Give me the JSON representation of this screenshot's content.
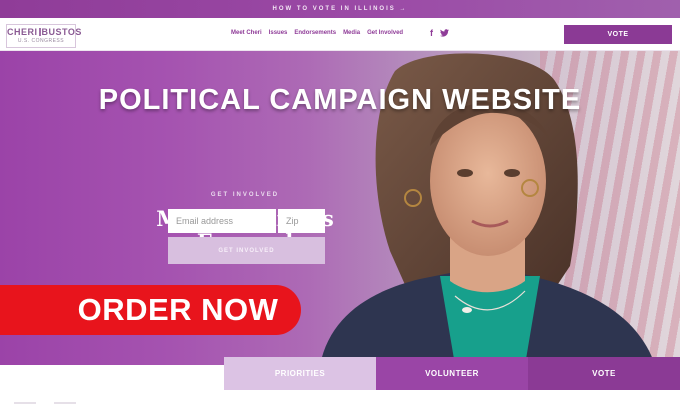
{
  "topbar": {
    "text": "HOW TO VOTE IN ILLINOIS →"
  },
  "logo": {
    "name_left": "CHERI",
    "name_right": "BUSTOS",
    "subtitle": "U.S. CONGRESS"
  },
  "nav": {
    "links": [
      "Meet Cheri",
      "Issues",
      "Endorsements",
      "Media",
      "Get Involved"
    ],
    "social": {
      "facebook": "f",
      "twitter": "🐦"
    },
    "vote_label": "VOTE"
  },
  "hero": {
    "overlay_title": "POLITICAL CAMPAIGN WEBSITE",
    "eyebrow": "GET INVOLVED",
    "headline_line1": "Moving Illinois",
    "headline_line2": "Forward",
    "email_placeholder": "Email address",
    "zip_placeholder": "Zip",
    "submit_label": "GET INVOLVED",
    "order_now": "ORDER NOW"
  },
  "tabs": [
    "PRIORITIES",
    "VOLUNTEER",
    "VOTE"
  ],
  "colors": {
    "brand_purple": "#8b3a95",
    "light_purple": "#dcc3e4",
    "order_red": "#e8141c"
  }
}
